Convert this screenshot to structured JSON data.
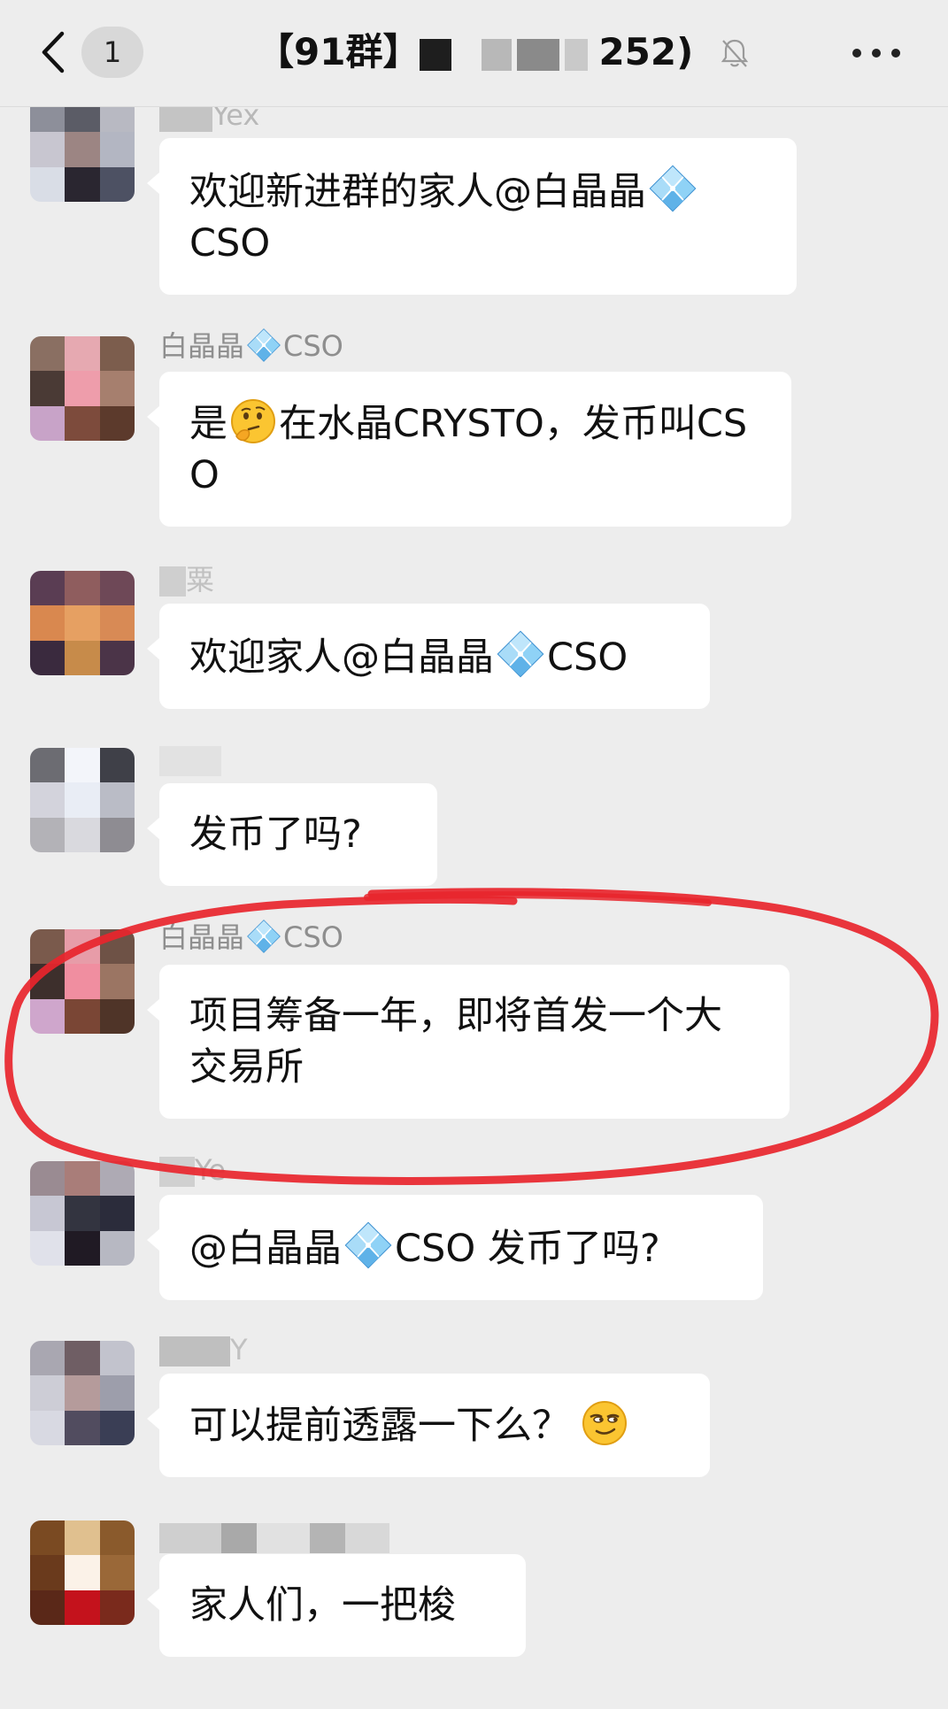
{
  "header": {
    "back_icon": "chevron-left-icon",
    "unread_count": "1",
    "title_prefix": "【91群】",
    "title_suffix": "252)",
    "mute_icon": "bell-muted-icon",
    "more_icon": "more-dots-icon"
  },
  "messages": [
    {
      "sender": "Yex",
      "text_before": "欢迎新进群的家人@白晶晶",
      "emoji": "crystal-icon",
      "text_after": "CSO"
    },
    {
      "sender_before": "白晶晶",
      "sender_emoji": "crystal-icon",
      "sender_after": "CSO",
      "text_before": "是",
      "emoji": "thinking-face-icon",
      "text_after": "在水晶CRYSTO，发币叫CSO"
    },
    {
      "sender": "粟",
      "text_before": "欢迎家人@白晶晶",
      "emoji": "crystal-icon",
      "text_after": "CSO"
    },
    {
      "sender": "",
      "text": "发币了吗?"
    },
    {
      "sender_before": "白晶晶",
      "sender_emoji": "crystal-icon",
      "sender_after": "CSO",
      "text": "项目筹备一年，即将首发一个大交易所"
    },
    {
      "sender": "Ye",
      "text_before": "@白晶晶",
      "emoji": "crystal-icon",
      "text_after": "CSO 发币了吗?"
    },
    {
      "sender": "Y",
      "text": "可以提前透露一下么？",
      "emoji": "smirk-face-icon"
    },
    {
      "sender": "",
      "text": "家人们，一把梭"
    }
  ],
  "colors": {
    "background": "#ededed",
    "bubble": "#ffffff",
    "highlight": "#e8252c",
    "sender_text": "#8e8e8e"
  }
}
